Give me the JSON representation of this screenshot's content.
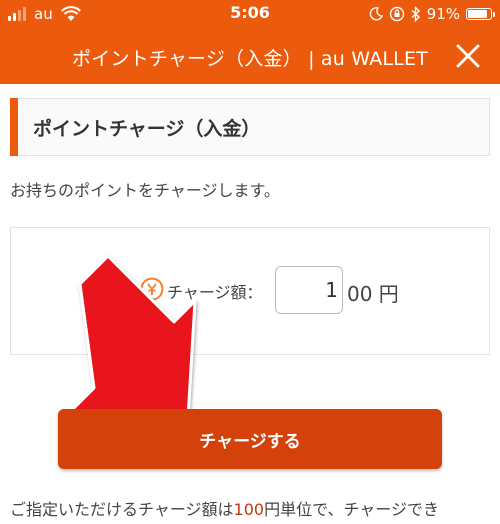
{
  "status_bar": {
    "carrier": "au",
    "time": "5:06",
    "battery": "91%",
    "battery_level": 0.91
  },
  "nav": {
    "title": "ポイントチャージ（入金） | au WALLET"
  },
  "section": {
    "title": "ポイントチャージ（入金）"
  },
  "intro": "お持ちのポイントをチャージします。",
  "charge": {
    "label": "チャージ額：",
    "value": "1",
    "suffix": "00 円"
  },
  "button": {
    "label": "チャージする"
  },
  "note": {
    "before": "ご指定いただけるチャージ額は",
    "highlight": "100",
    "after": "円単位で、チャージでき"
  },
  "colors": {
    "brand": "#ec5a0e",
    "button": "#d4410a",
    "arrow": "#e8141c"
  },
  "icons": [
    "signal-icon",
    "wifi-icon",
    "moon-icon",
    "orientation-lock-icon",
    "bluetooth-icon",
    "battery-icon",
    "close-icon",
    "coin-icon",
    "arrow-pointer-icon"
  ]
}
